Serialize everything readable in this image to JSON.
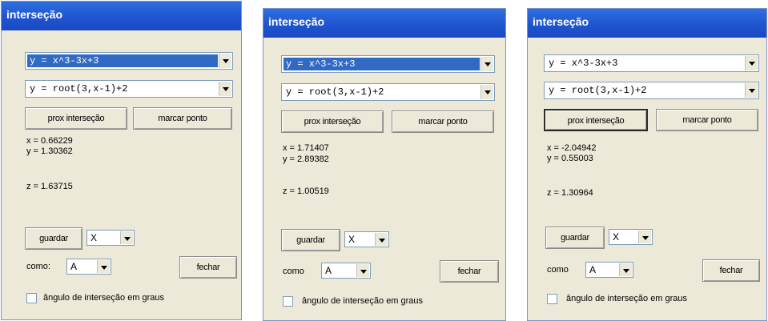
{
  "panels": [
    {
      "title": "interseção",
      "combo1": "y = x^3-3x+3",
      "combo2": "y = root(3,x-1)+2",
      "btn_prox": "prox interseção",
      "btn_marcar": "marcar ponto",
      "x_line": "x = 0.66229",
      "y_line": "y = 1.30362",
      "z_line": "z = 1.63715",
      "guardar": "guardar",
      "guardar_select": "X",
      "como_label": "como:",
      "como_select": "A",
      "fechar": "fechar",
      "checkbox_label": "ângulo de interseção em graus"
    },
    {
      "title": "interseção",
      "combo1": "y = x^3-3x+3",
      "combo2": "y = root(3,x-1)+2",
      "btn_prox": "prox interseção",
      "btn_marcar": "marcar ponto",
      "x_line": "x = 1.71407",
      "y_line": "y = 2.89382",
      "z_line": "z = 1.00519",
      "guardar": "guardar",
      "guardar_select": "X",
      "como_label": "como",
      "como_select": "A",
      "fechar": "fechar",
      "checkbox_label": "ângulo de interseção em graus"
    },
    {
      "title": "interseção",
      "combo1": "y = x^3-3x+3",
      "combo2": "y = root(3,x-1)+2",
      "btn_prox": "prox interseção",
      "btn_marcar": "marcar ponto",
      "x_line": "x = -2.04942",
      "y_line": "y = 0.55003",
      "z_line": "z = 1.30964",
      "guardar": "guardar",
      "guardar_select": "X",
      "como_label": "como",
      "como_select": "A",
      "fechar": "fechar",
      "checkbox_label": "ângulo de interseção em graus"
    }
  ]
}
